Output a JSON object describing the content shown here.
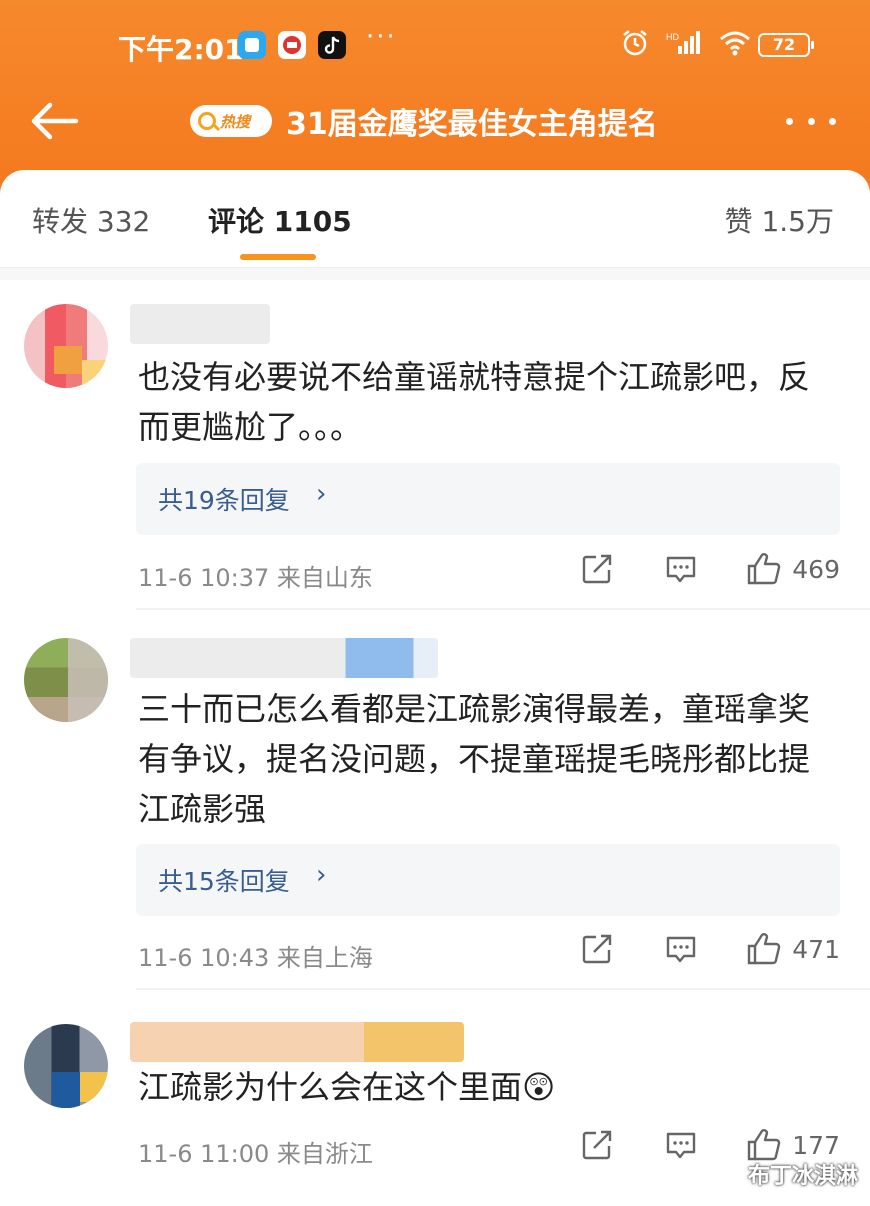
{
  "status": {
    "time": "下午2:01",
    "dots": "···",
    "battery": "72"
  },
  "header": {
    "hot_badge": "热搜",
    "title": "31届金鹰奖最佳女主角提名"
  },
  "tabs": {
    "repost": "转发 332",
    "comment": "评论 1105",
    "like": "赞 1.5万"
  },
  "comments": [
    {
      "text": "也没有必要说不给童谣就特意提个江疏影吧，反而更尴尬了。。。",
      "replies": "共19条回复",
      "meta": "11-6 10:37 来自山东",
      "likes": "469"
    },
    {
      "text": "三十而已怎么看都是江疏影演得最差，童瑶拿奖有争议，提名没问题，不提童瑶提毛晓彤都比提江疏影强",
      "replies": "共15条回复",
      "meta": "11-6 10:43 来自上海",
      "likes": "471"
    },
    {
      "text": "江疏影为什么会在这个里面😲",
      "meta": "11-6 11:00 来自浙江",
      "likes": "177"
    }
  ],
  "watermark": "布丁冰淇淋",
  "colors": {
    "header_orange": "#f4781e",
    "link_blue": "#3a5d90",
    "tab_accent": "#f7941e"
  }
}
